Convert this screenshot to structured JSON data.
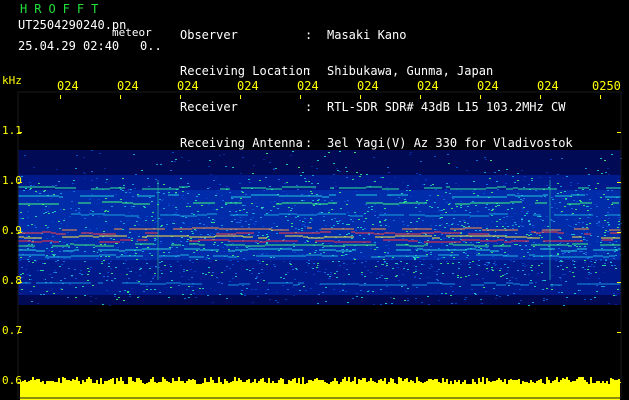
{
  "header": {
    "program": "HROFFT",
    "filename": "UT2504290240.pn",
    "meteor_label": "meteor",
    "datetime": "25.04.29 02:40",
    "count": "0.."
  },
  "info": [
    {
      "label": "Observer",
      "sep": ":",
      "value": "Masaki Kano"
    },
    {
      "label": "Receiving Location",
      "sep": ":",
      "value": "Shibukawa, Gunma, Japan"
    },
    {
      "label": "Receiver",
      "sep": ":",
      "value": "RTL-SDR SDR# 43dB L15 103.2MHz CW"
    },
    {
      "label": "Receiving Antenna",
      "sep": ":",
      "value": "3el Yagi(V) Az 330 for Vladivostok"
    }
  ],
  "axis": {
    "y_unit": "kHz",
    "y_ticks": [
      "1.1",
      "1.0",
      "0.9",
      "0.8",
      "0.7",
      "0.6"
    ],
    "x_ticks": [
      "024",
      "024",
      "024",
      "024",
      "024",
      "024",
      "024",
      "024",
      "024",
      "0250"
    ]
  },
  "colors": {
    "background": "#000000",
    "label": "#ffff00",
    "program": "#22e03a",
    "text": "#ffffff"
  }
}
